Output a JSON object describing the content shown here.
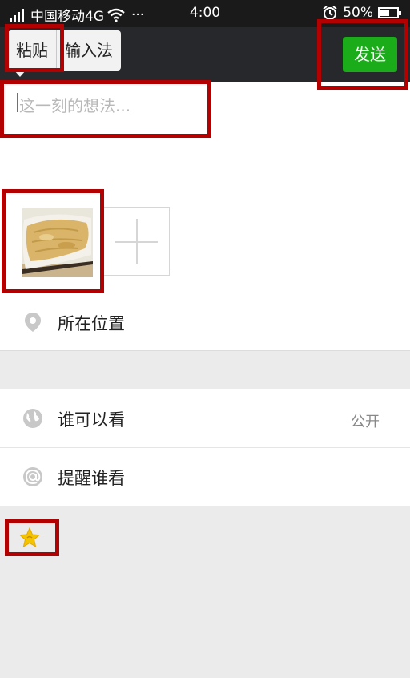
{
  "status_bar": {
    "carrier": "中国移动4G",
    "more": "···",
    "time": "4:00",
    "battery": "50%"
  },
  "context_menu": {
    "paste_label": "粘贴",
    "input_method_label": "输入法"
  },
  "toolbar": {
    "send_label": "发送",
    "send_color": "#1aad19"
  },
  "composer": {
    "placeholder": "这一刻的想法...",
    "value": ""
  },
  "photos": {
    "items": [
      {
        "icon": "food-photo"
      }
    ],
    "add_icon": "plus-icon"
  },
  "location": {
    "icon": "location-pin-icon",
    "label": "所在位置"
  },
  "visibility": {
    "icon": "globe-icon",
    "label": "谁可以看",
    "value": "公开"
  },
  "mention": {
    "icon": "at-icon",
    "label": "提醒谁看"
  },
  "emoji": {
    "icon": "star-emoji-icon",
    "color": "#f5c400"
  },
  "annotation_color": "#b30000"
}
